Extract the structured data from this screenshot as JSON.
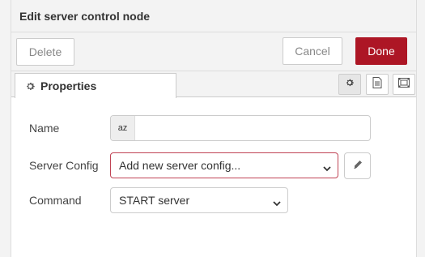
{
  "dialog": {
    "title": "Edit server control node"
  },
  "toolbar": {
    "delete_label": "Delete",
    "cancel_label": "Cancel",
    "done_label": "Done"
  },
  "tabs": {
    "properties_label": "Properties"
  },
  "form": {
    "name_label": "Name",
    "name_value": "",
    "name_prefix": "az",
    "server_config_label": "Server Config",
    "server_config_value": "Add new server config...",
    "command_label": "Command",
    "command_value": "START server"
  },
  "colors": {
    "done_bg": "#ad1625",
    "invalid_border": "#c04455"
  }
}
